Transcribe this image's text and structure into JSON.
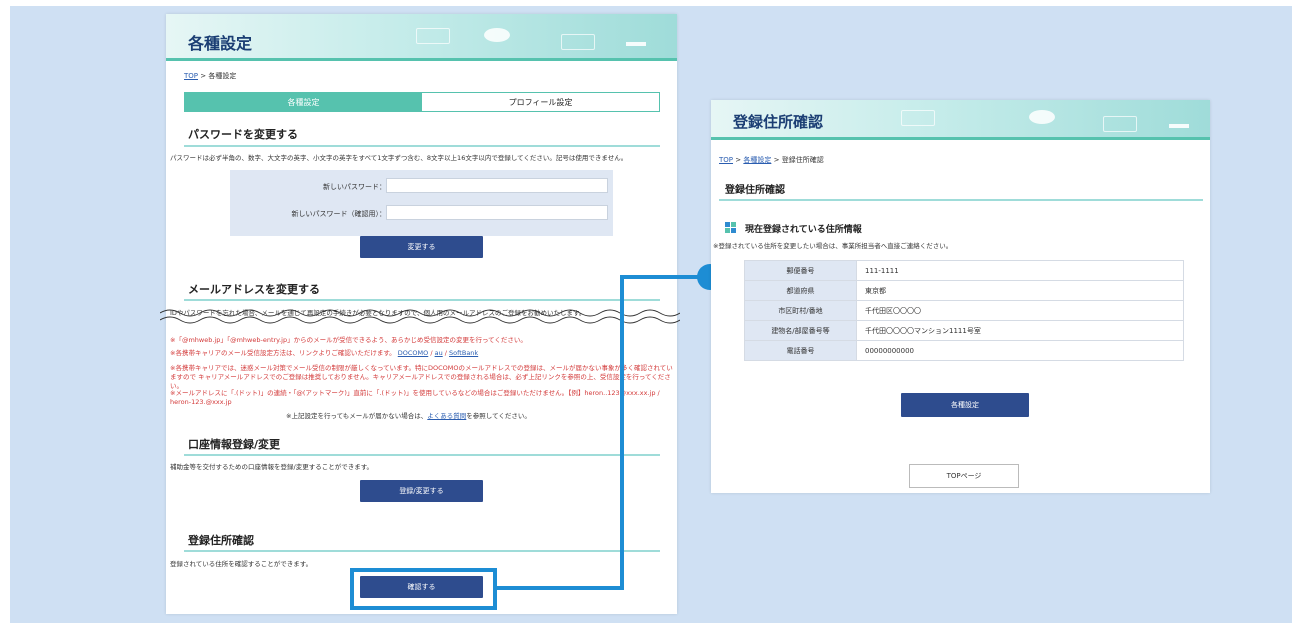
{
  "colors": {
    "accent": "#56c2ae",
    "navy_button": "#2e4c8e",
    "highlight_blue": "#1d8dd4",
    "background": "#cfe0f3"
  },
  "left": {
    "header_title": "各種設定",
    "breadcrumb": {
      "top": "TOP",
      "sep": ">",
      "current": "各種設定"
    },
    "tabs": [
      "各種設定",
      "プロフィール設定"
    ],
    "password": {
      "title": "パスワードを変更する",
      "description": "パスワードは必ず半角の、数字、大文字の英字、小文字の英字をすべて1文字ずつ含む、8文字以上16文字以内で登録してください。記号は使用できません。",
      "new_label": "新しいパスワード：",
      "confirm_label": "新しいパスワード（確認用）：",
      "button": "変更する"
    },
    "email": {
      "title": "メールアドレスを変更する",
      "description": "IDやパスワードを忘れた場合、メールを通じて再設定の手続きが必要となりますので、個人用のメールアドレスのご登録をお勧めいたします。",
      "note1": "※「@mhweb.jp」「@mhweb-entry.jp」からのメールが受信できるよう、あらかじめ受信設定の変更を行ってください。",
      "note2_prefix": "※各携帯キャリアのメール受信設定方法は、リンクよりご確認いただけます。",
      "carriers": [
        "DOCOMO",
        "au",
        "SoftBank"
      ],
      "note3": "※各携帯キャリアでは、迷惑メール対策でメール受信の制限が厳しくなっています。特にDOCOMOのメールアドレスでの登録は、メールが届かない事象が多く確認されていますので キャリアメールアドレスでのご登録は推奨しておりません。キャリアメールアドレスでの登録される場合は、必ず上記リンクを参照の上、受信設定を行ってください。",
      "note4": "※メールアドレスに「.(ドット)」の連続・「@(アットマーク)」直前に「.(ドット)」を使用しているなどの場合はご登録いただけません。【例】heron..123@xxx.xx.jp / heron-123.@xxx.jp",
      "note5_prefix": "※上記設定を行ってもメールが届かない場合は、",
      "faq_link": "よくある質問",
      "note5_suffix": "を参照してください。"
    },
    "bank": {
      "title": "口座情報登録/変更",
      "description": "補助金等を交付するための口座情報を登録/変更することができます。",
      "button": "登録/変更する"
    },
    "address": {
      "title": "登録住所確認",
      "description": "登録されている住所を確認することができます。",
      "button": "確認する"
    }
  },
  "right": {
    "header_title": "登録住所確認",
    "breadcrumb": {
      "top": "TOP",
      "sep1": ">",
      "settings": "各種設定",
      "sep2": ">",
      "current": "登録住所確認"
    },
    "section_title": "登録住所確認",
    "info_title": "現在登録されている住所情報",
    "info_note": "※登録されている住所を変更したい場合は、事業所担当者へ直接ご連絡ください。",
    "rows": [
      {
        "label": "郵便番号",
        "value": "111-1111"
      },
      {
        "label": "都道府県",
        "value": "東京都"
      },
      {
        "label": "市区町村/番地",
        "value": "千代田区〇〇〇〇"
      },
      {
        "label": "建物名/部屋番号等",
        "value": "千代田〇〇〇〇マンション1111号室"
      },
      {
        "label": "電話番号",
        "value": "00000000000"
      }
    ],
    "settings_button": "各種設定",
    "top_button": "TOPページ"
  }
}
